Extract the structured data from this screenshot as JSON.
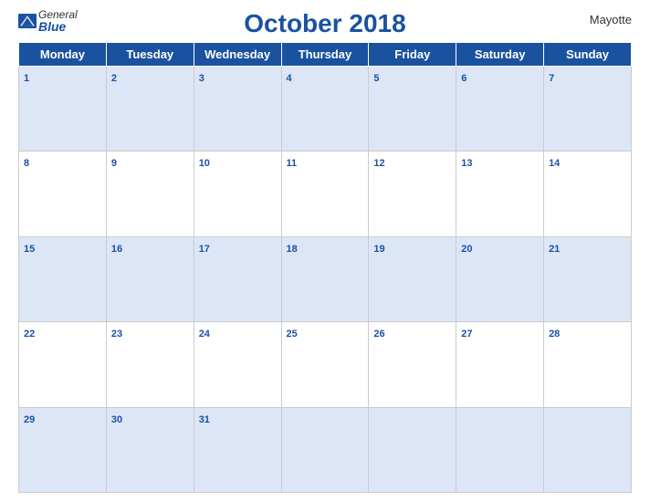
{
  "header": {
    "logo_general": "General",
    "logo_blue": "Blue",
    "title": "October 2018",
    "region": "Mayotte"
  },
  "weekdays": [
    "Monday",
    "Tuesday",
    "Wednesday",
    "Thursday",
    "Friday",
    "Saturday",
    "Sunday"
  ],
  "weeks": [
    [
      1,
      2,
      3,
      4,
      5,
      6,
      7
    ],
    [
      8,
      9,
      10,
      11,
      12,
      13,
      14
    ],
    [
      15,
      16,
      17,
      18,
      19,
      20,
      21
    ],
    [
      22,
      23,
      24,
      25,
      26,
      27,
      28
    ],
    [
      29,
      30,
      31,
      null,
      null,
      null,
      null
    ]
  ]
}
